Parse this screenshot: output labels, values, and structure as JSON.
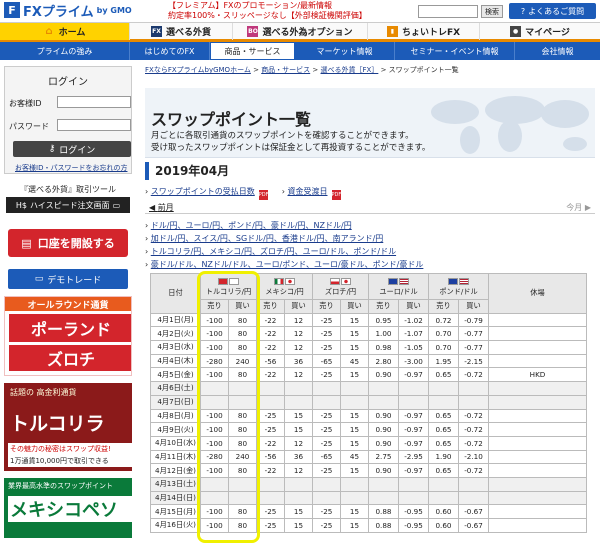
{
  "header": {
    "logo_mark": "F",
    "logo_name": "FXプライム",
    "logo_by": "by GMO",
    "news_lines": [
      "【フレミアム】FXのプロモーション/最新情報",
      "約定率100%・スリッページなし【外部検証機関評価】"
    ],
    "search_button": "検索",
    "faq_label": "よくあるご質問"
  },
  "product_tabs": [
    {
      "label": "ホーム",
      "icon": "home-icon",
      "color": "#e88a00"
    },
    {
      "label": "選べる外貨",
      "icon": "fx-icon",
      "color": "#1c5bb8"
    },
    {
      "label": "選べる外為オプション",
      "icon": "bo-icon",
      "color": "#c0397c"
    },
    {
      "label": "ちょいトレFX",
      "icon": "chart-icon",
      "color": "#d3252c"
    },
    {
      "label": "マイページ",
      "icon": "person-icon",
      "color": "#444444"
    }
  ],
  "nav": [
    "プライムの強み",
    "はじめてのFX",
    "商品・サービス",
    "マーケット情報",
    "セミナー・イベント情報",
    "会社情報"
  ],
  "sidebar": {
    "login_title": "ログイン",
    "id_label": "お客様ID",
    "pw_label": "パスワード",
    "login_button": "ログイン",
    "forgot": "お客様ID・パスワードをお忘れの方",
    "tool_label": "『選べる外貨』取引ツール",
    "hs_label": "ハイスピード注文画面",
    "open_account": "口座を開設する",
    "demo": "デモトレード",
    "banner1_top": "オールラウンド通貨",
    "banner1_a": "ポーランド",
    "banner1_b": "ズロチ",
    "banner2_top": "話題の 高金利通貨",
    "banner2_big": "トルコリラ",
    "banner2_sub1": "その魅力の秘密はスワップ収益!",
    "banner2_sub2": "1万通貨10,000円で取引できる",
    "banner3_top": "業界最高水準のスワップポイント",
    "banner3_big": "メキシコペソ"
  },
  "main": {
    "breadcrumb": [
      "FXならFXプライムbyGMOホーム",
      "商品・サービス",
      "選べる外貨［FX］",
      "スワップポイント一覧"
    ],
    "title": "スワップポイント一覧",
    "desc1": "月ごとに各取引通貨のスワップポイントを確認することができます。",
    "desc2": "受け取ったスワップポイントは保証金として再投資することができます。",
    "month": "2019年04月",
    "link_days": "スワップポイントの受払日数",
    "link_accept": "資金受渡日",
    "prev": "前月",
    "next": "今月",
    "pairs": [
      "ドル/円、ユーロ/円、ポンド/円、豪ドル/円、NZドル/円",
      "加ドル/円、スイス/円、SGドル/円、香港ドル/円、南アランド/円",
      "トルコリラ/円、メキシコ/円、ズロチ/円、ユーロ/ドル、ポンド/ドル",
      "豪ドル/ドル、NZドル/ドル、ユーロ/ポンド、ユーロ/豪ドル、ポンド/豪ドル"
    ]
  },
  "table": {
    "date_header": "日付",
    "holiday_header": "休場",
    "sell": "売り",
    "buy": "買い",
    "currencies": [
      {
        "name": "トルコリラ/円",
        "flags": [
          "#d3252c",
          "#ffffff"
        ]
      },
      {
        "name": "メキシコ/円",
        "flags": [
          "#0a7a3a",
          "#ffffff"
        ]
      },
      {
        "name": "ズロチ/円",
        "flags": [
          "#ffffff",
          "#ffffff"
        ]
      },
      {
        "name": "ユーロ/ドル",
        "flags": [
          "#1c3fa0",
          "#b22234"
        ]
      },
      {
        "name": "ポンド/ドル",
        "flags": [
          "#1c3fa0",
          "#b22234"
        ]
      }
    ],
    "rows": [
      {
        "date": "4月1日(月)",
        "v": [
          "-100",
          "80",
          "-22",
          "12",
          "-25",
          "15",
          "0.95",
          "-1.02",
          "0.72",
          "-0.79"
        ],
        "holiday": "",
        "weekend": false
      },
      {
        "date": "4月2日(火)",
        "v": [
          "-100",
          "80",
          "-22",
          "12",
          "-25",
          "15",
          "1.00",
          "-1.07",
          "0.70",
          "-0.77"
        ],
        "holiday": "",
        "weekend": false
      },
      {
        "date": "4月3日(水)",
        "v": [
          "-100",
          "80",
          "-22",
          "12",
          "-25",
          "15",
          "0.98",
          "-1.05",
          "0.70",
          "-0.77"
        ],
        "holiday": "",
        "weekend": false
      },
      {
        "date": "4月4日(木)",
        "v": [
          "-280",
          "240",
          "-56",
          "36",
          "-65",
          "45",
          "2.80",
          "-3.00",
          "1.95",
          "-2.15"
        ],
        "holiday": "",
        "weekend": false
      },
      {
        "date": "4月5日(金)",
        "v": [
          "-100",
          "80",
          "-22",
          "12",
          "-25",
          "15",
          "0.90",
          "-0.97",
          "0.65",
          "-0.72"
        ],
        "holiday": "HKD",
        "weekend": false
      },
      {
        "date": "4月6日(土)",
        "v": [
          "",
          "",
          "",
          "",
          "",
          "",
          "",
          "",
          "",
          ""
        ],
        "holiday": "",
        "weekend": true
      },
      {
        "date": "4月7日(日)",
        "v": [
          "",
          "",
          "",
          "",
          "",
          "",
          "",
          "",
          "",
          ""
        ],
        "holiday": "",
        "weekend": true
      },
      {
        "date": "4月8日(月)",
        "v": [
          "-100",
          "80",
          "-25",
          "15",
          "-25",
          "15",
          "0.90",
          "-0.97",
          "0.65",
          "-0.72"
        ],
        "holiday": "",
        "weekend": false
      },
      {
        "date": "4月9日(火)",
        "v": [
          "-100",
          "80",
          "-25",
          "15",
          "-25",
          "15",
          "0.90",
          "-0.97",
          "0.65",
          "-0.72"
        ],
        "holiday": "",
        "weekend": false
      },
      {
        "date": "4月10日(水)",
        "v": [
          "-100",
          "80",
          "-22",
          "12",
          "-25",
          "15",
          "0.90",
          "-0.97",
          "0.65",
          "-0.72"
        ],
        "holiday": "",
        "weekend": false
      },
      {
        "date": "4月11日(木)",
        "v": [
          "-280",
          "240",
          "-56",
          "36",
          "-65",
          "45",
          "2.75",
          "-2.95",
          "1.90",
          "-2.10"
        ],
        "holiday": "",
        "weekend": false
      },
      {
        "date": "4月12日(金)",
        "v": [
          "-100",
          "80",
          "-22",
          "12",
          "-25",
          "15",
          "0.90",
          "-0.97",
          "0.65",
          "-0.72"
        ],
        "holiday": "",
        "weekend": false
      },
      {
        "date": "4月13日(土)",
        "v": [
          "",
          "",
          "",
          "",
          "",
          "",
          "",
          "",
          "",
          ""
        ],
        "holiday": "",
        "weekend": true
      },
      {
        "date": "4月14日(日)",
        "v": [
          "",
          "",
          "",
          "",
          "",
          "",
          "",
          "",
          "",
          ""
        ],
        "holiday": "",
        "weekend": true
      },
      {
        "date": "4月15日(月)",
        "v": [
          "-100",
          "80",
          "-25",
          "15",
          "-25",
          "15",
          "0.88",
          "-0.95",
          "0.60",
          "-0.67"
        ],
        "holiday": "",
        "weekend": false
      },
      {
        "date": "4月16日(火)",
        "v": [
          "-100",
          "80",
          "-25",
          "15",
          "-25",
          "15",
          "0.88",
          "-0.95",
          "0.60",
          "-0.67"
        ],
        "holiday": "",
        "weekend": false
      }
    ]
  },
  "highlight_color": "#f0f000"
}
